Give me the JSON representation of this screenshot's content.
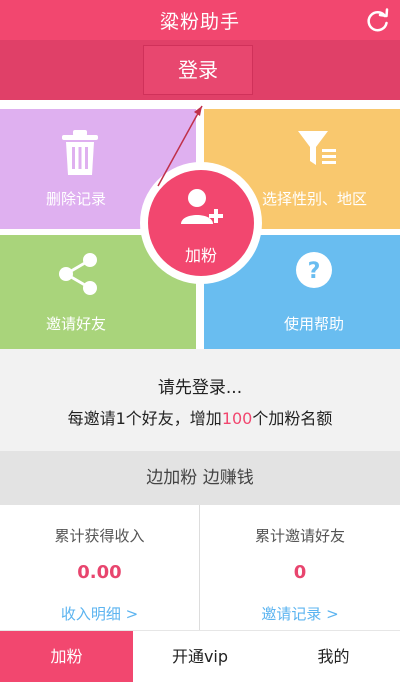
{
  "header": {
    "title": "粱粉助手",
    "refresh_icon": "refresh-icon"
  },
  "login": {
    "label": "登录"
  },
  "tiles": {
    "delete": {
      "label": "删除记录",
      "icon": "trash-icon"
    },
    "filter": {
      "label": "选择性别、地区",
      "icon": "filter-icon"
    },
    "share": {
      "label": "邀请好友",
      "icon": "share-icon"
    },
    "help": {
      "label": "使用帮助",
      "icon": "question-icon"
    },
    "add": {
      "label": "加粉",
      "icon": "add-user-icon"
    }
  },
  "info": {
    "line1": "请先登录...",
    "line2_prefix": "每邀请1个好友，增加",
    "line2_highlight": "100",
    "line2_suffix": "个加粉名额"
  },
  "slogan": "边加粉 边赚钱",
  "stats": {
    "income": {
      "caption": "累计获得收入",
      "value": "0.00",
      "link": "收入明细 >"
    },
    "invites": {
      "caption": "累计邀请好友",
      "value": "0",
      "link": "邀请记录 >"
    }
  },
  "tabs": [
    {
      "label": "加粉"
    },
    {
      "label": "开通vip"
    },
    {
      "label": "我的"
    }
  ],
  "colors": {
    "brand": "#f2476f",
    "highlight": "#f2476f",
    "link": "#5cb4f0"
  }
}
